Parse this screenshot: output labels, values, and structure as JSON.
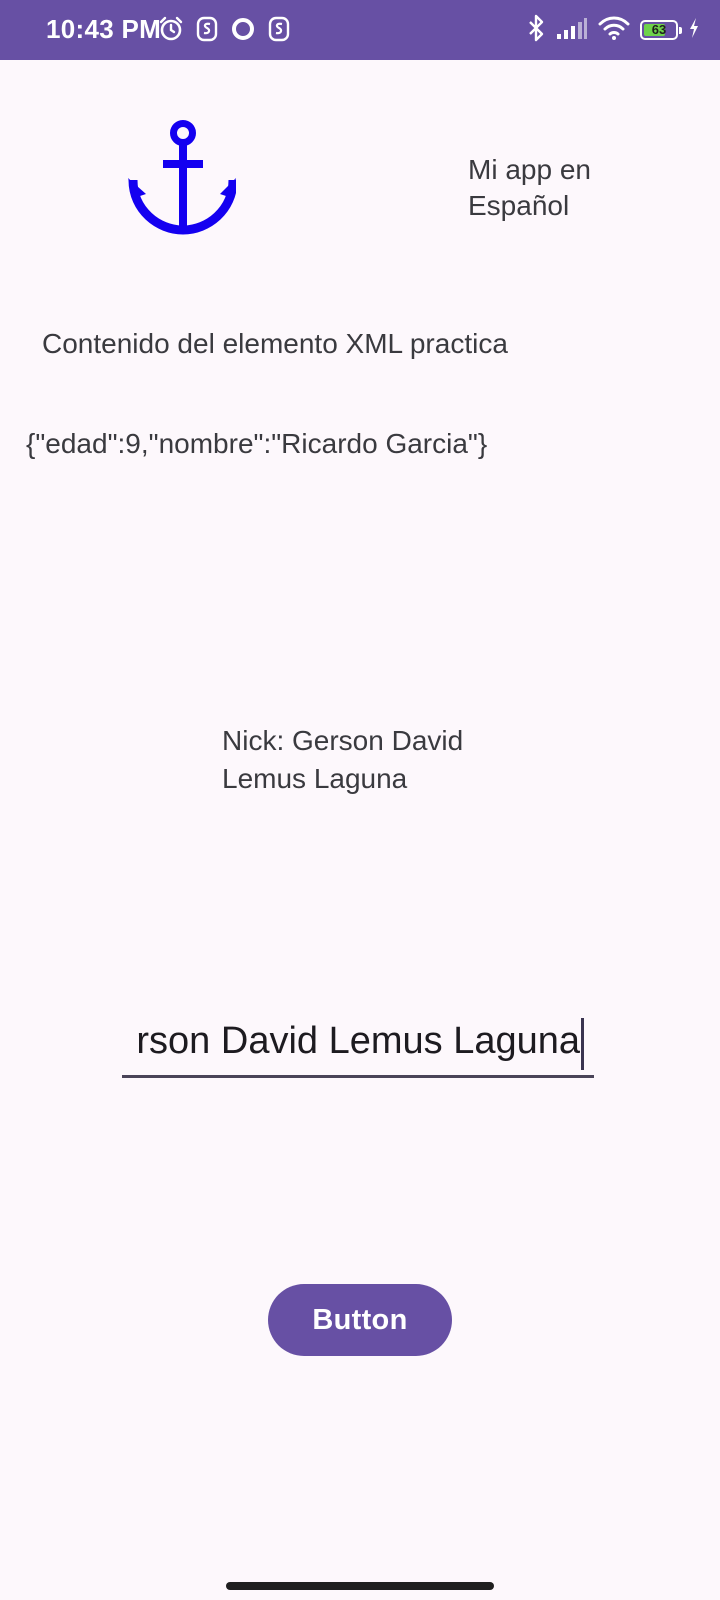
{
  "status_bar": {
    "time": "10:43 PM",
    "battery_level": "63",
    "left_icons": [
      "alarm-icon",
      "notification-s-icon",
      "circle-icon",
      "notification-s-icon"
    ],
    "right_icons": [
      "bluetooth-icon",
      "signal-icon",
      "wifi-icon",
      "battery-icon",
      "charging-icon"
    ]
  },
  "header": {
    "logo_icon": "anchor-icon",
    "logo_color": "#1400F0",
    "app_title": "Mi app en Español"
  },
  "content": {
    "xml_label": "Contenido del elemento XML practica",
    "json_text": "{\"edad\":9,\"nombre\":\"Ricardo Garcia\"}",
    "nick_text": "Nick: Gerson David Lemus Laguna"
  },
  "edit_field": {
    "value": "rson David Lemus Laguna"
  },
  "button": {
    "label": "Button"
  },
  "colors": {
    "primary": "#6750A4",
    "background": "#FDF8FC"
  }
}
